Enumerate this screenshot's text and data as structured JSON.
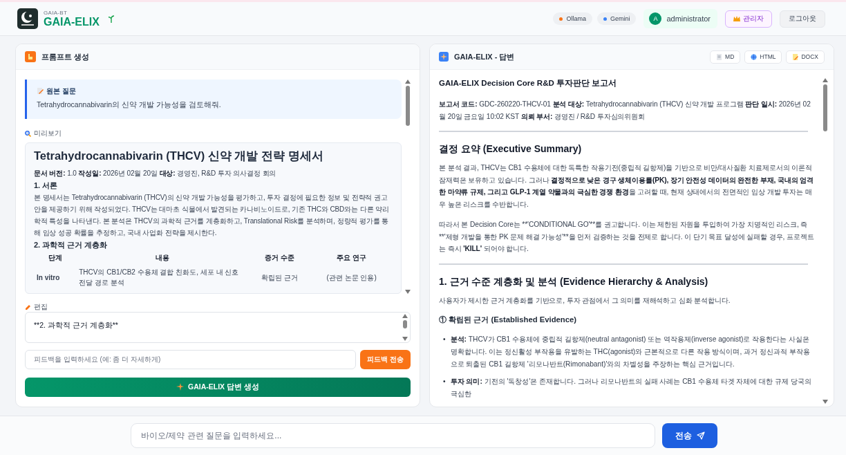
{
  "header": {
    "brand_small": "GAIA-BT",
    "brand": "GAIA-ELIX",
    "models": [
      {
        "label": "Ollama",
        "color": "#f97316"
      },
      {
        "label": "Gemini",
        "color": "#3b82f6"
      }
    ],
    "user": {
      "initial": "A",
      "name": "administrator"
    },
    "role_button": "관리자",
    "logout_button": "로그아웃"
  },
  "prompt_panel": {
    "title": "프롬프트 생성",
    "question": {
      "label": "원본 질문",
      "text": "Tetrahydrocannabivarin의 신약 개발 가능성을 검토해줘."
    },
    "preview_label": "미리보기",
    "preview": [
      {
        "kind": "title",
        "text": "Tetrahydrocannabivarin (THCV) 신약 개발 전략 명세서"
      },
      {
        "kind": "para",
        "parts": [
          {
            "text": "문서 버전:",
            "bold": true
          },
          {
            "text": " 1.0 ",
            "bold": false
          },
          {
            "text": "작성일:",
            "bold": true
          },
          {
            "text": " 2026년 02월 20일 ",
            "bold": false
          },
          {
            "text": "대상:",
            "bold": true
          },
          {
            "text": " 경영진, R&D 투자 의사결정 회의",
            "bold": false
          }
        ]
      },
      {
        "kind": "section",
        "text": "1. 서론"
      },
      {
        "kind": "para",
        "parts": [
          {
            "text": "본 명세서는 Tetrahydrocannabivarin (THCV)의 신약 개발 가능성을 평가하고, 투자 결정에 필요한 정보 및 전략적 권고안을 제공하기 위해 작성되었다. THCV는 대마초 식물에서 발견되는 카나비노이드로, 기존 THC와 CBD와는 다른 약리학적 특성을 나타낸다. 본 분석은 THCV의 과학적 근거를 계층화하고, Translational Risk를 분석하며, 정량적 평가를 통해 임상 성공 확률을 추정하고, 국내 사업화 전략을 제시한다.",
            "bold": false
          }
        ]
      },
      {
        "kind": "section",
        "text": "2. 과학적 근거 계층화"
      },
      {
        "kind": "table",
        "columns": [
          "단계",
          "내용",
          "증거 수준",
          "주요 연구"
        ],
        "rows": [
          [
            "In vitro",
            "THCV의 CB1/CB2 수용체 결합 친화도, 세포 내 신호 전달 경로 분석",
            "확립된 근거",
            "(관련 논문 인용)"
          ]
        ]
      }
    ],
    "edit_label": "편집",
    "edit_value": "**2. 과학적 근거 계층화**",
    "feedback": {
      "placeholder": "피드백을 입력하세요 (예: 좀 더 자세하게)",
      "button": "피드백 전송"
    },
    "generate_button": "GAIA-ELIX 답변 생성"
  },
  "answer_panel": {
    "title": "GAIA-ELIX - 답변",
    "exports": [
      {
        "kind": "md",
        "label": "MD"
      },
      {
        "kind": "html",
        "label": "HTML"
      },
      {
        "kind": "docx",
        "label": "DOCX"
      }
    ],
    "content": [
      {
        "kind": "report_title",
        "text": "GAIA-ELIX Decision Core R&D 투자판단 보고서"
      },
      {
        "kind": "para",
        "parts": [
          {
            "text": "보고서 코드:",
            "bold": true
          },
          {
            "text": " GDC-260220-THCV-01 ",
            "bold": false
          },
          {
            "text": "분석 대상:",
            "bold": true
          },
          {
            "text": " Tetrahydrocannabivarin (THCV) 신약 개발 프로그램 ",
            "bold": false
          },
          {
            "text": "판단 일시:",
            "bold": true
          },
          {
            "text": " 2026년 02월 20일 금요일 10:02 KST ",
            "bold": false
          },
          {
            "text": "의뢰 부서:",
            "bold": true
          },
          {
            "text": " 경영진 / R&D 투자심의위원회",
            "bold": false
          }
        ]
      },
      {
        "kind": "rule"
      },
      {
        "kind": "heading",
        "text": "결정 요약 (Executive Summary)"
      },
      {
        "kind": "para",
        "parts": [
          {
            "text": "본 분석 결과, THCV는 CB1 수용체에 대한 독특한 작용기전(중립적 길항제)을 기반으로 비만/대사질환 치료제로서의 이론적 잠재력은 보유하고 있습니다. 그러나 ",
            "bold": false
          },
          {
            "text": "결정적으로 낮은 경구 생체이용률(PK), 장기 안전성 데이터의 완전한 부재, 국내의 엄격한 마약류 규제, 그리고 GLP-1 계열 약물과의 극심한 경쟁 환경",
            "bold": true
          },
          {
            "text": "을 고려할 때, 현재 상태에서의 전면적인 임상 개발 투자는 매우 높은 리스크를 수반합니다.",
            "bold": false
          }
        ]
      },
      {
        "kind": "para",
        "parts": [
          {
            "text": "따라서 본 Decision Core는 **'CONDITIONAL GO'**를 권고합니다. 이는 제한된 자원을 투입하여 가장 치명적인 리스크, 즉 **'제형 개발을 통한 PK 문제 해결 가능성'**을 먼저 검증하는 것을 전제로 합니다. 이 단기 목표 달성에 실패할 경우, 프로젝트는 즉시 ",
            "bold": false
          },
          {
            "text": "'KILL'",
            "bold": true
          },
          {
            "text": " 되어야 합니다.",
            "bold": false
          }
        ]
      },
      {
        "kind": "rule"
      },
      {
        "kind": "heading",
        "text": "1. 근거 수준 계층화 및 분석 (Evidence Hierarchy & Analysis)"
      },
      {
        "kind": "para",
        "parts": [
          {
            "text": "사용자가 제시한 근거 계층화를 기반으로, 투자 관점에서 그 의미를 재해석하고 심화 분석합니다.",
            "bold": false
          }
        ]
      },
      {
        "kind": "subheading",
        "text": "① 확립된 근거 (Established Evidence)"
      },
      {
        "kind": "bullets",
        "items": [
          {
            "marker": "•",
            "parts": [
              {
                "text": "분석:",
                "bold": true
              },
              {
                "text": " THCV가 CB1 수용체에 중립적 길항제(neutral antagonist) 또는 역작용제(inverse agonist)로 작용한다는 사실은 명확합니다. 이는 정신활성 부작용을 유발하는 THC(agonist)와 근본적으로 다른 작용 방식이며, 과거 정신과적 부작용으로 퇴출된 CB1 길항제 '리모나반트(Rimonabant)'와의 차별성을 주장하는 핵심 근거입니다.",
                "bold": false
              }
            ]
          },
          {
            "marker": "•",
            "parts": [
              {
                "text": "투자 의미:",
                "bold": true
              },
              {
                "text": " 기전의 '독창성'은 존재합니다. 그러나 리모나반트의 실패 사례는 CB1 수용체 타겟 자체에 대한 규제 당국의 극심한",
                "bold": false
              }
            ]
          }
        ]
      }
    ]
  },
  "chat": {
    "placeholder": "바이오/제약 관련 질문을 입력하세요...",
    "send_button": "전송"
  }
}
